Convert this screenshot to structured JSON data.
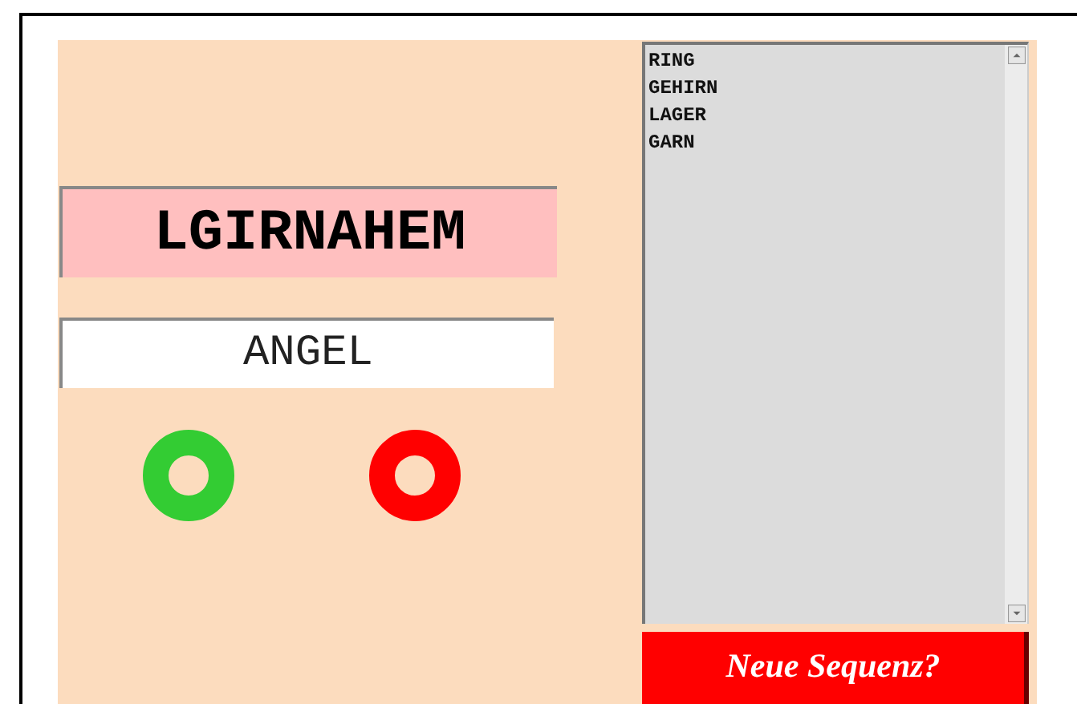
{
  "puzzle": {
    "letters": "LGIRNAHEM"
  },
  "answer": {
    "value": "ANGEL"
  },
  "found_words": [
    "RING",
    "GEHIRN",
    "LAGER",
    "GARN"
  ],
  "new_button": {
    "label": "Neue Sequenz?"
  }
}
